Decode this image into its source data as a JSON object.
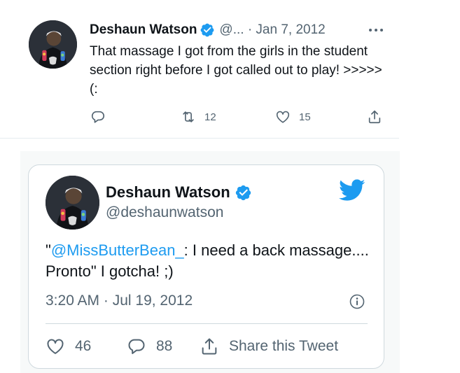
{
  "colors": {
    "accent": "#1d9bf0",
    "text": "#0f1419",
    "secondary": "#536471",
    "border": "#cfd9de"
  },
  "tweet": {
    "author_name": "Deshaun Watson",
    "meta": "@... · Jan 7, 2012",
    "text": "That massage I got from the girls in the student section right before I got called out to play! >>>>> (:",
    "retweets": "12",
    "likes": "15",
    "icons": {
      "verified": "verified-badge-icon",
      "more": "more-dots-icon",
      "reply": "reply-icon",
      "retweet": "retweet-icon",
      "like": "heart-icon",
      "share": "share-icon"
    }
  },
  "embed": {
    "author_name": "Deshaun Watson",
    "handle": "@deshaunwatson",
    "text_prefix": "\"",
    "mention": "@MissButterBean_",
    "text_suffix": ": I need a back massage.... Pronto\" I gotcha! ;)",
    "timestamp": "3:20 AM · Jul 19, 2012",
    "likes": "46",
    "replies": "88",
    "share_label": "Share this Tweet",
    "icons": {
      "logo": "twitter-bird-icon",
      "info": "info-icon",
      "like": "heart-icon",
      "reply": "reply-icon",
      "share": "share-icon"
    }
  }
}
